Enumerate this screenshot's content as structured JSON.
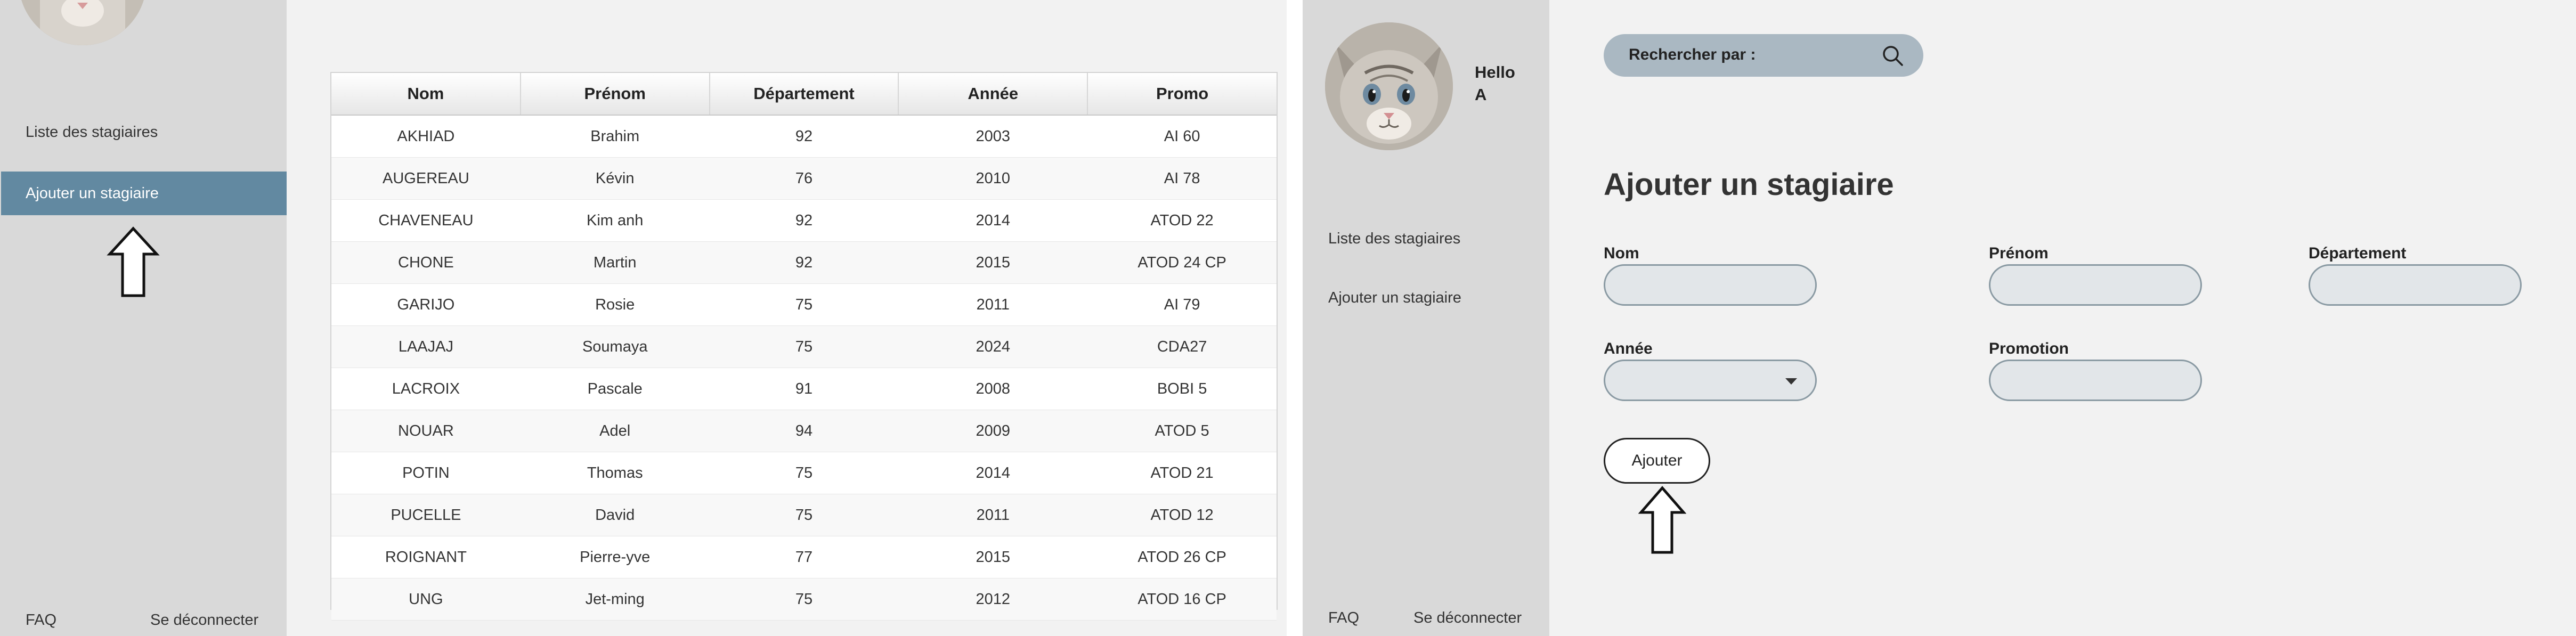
{
  "left": {
    "nav": {
      "list_label": "Liste des stagiaires",
      "add_label": "Ajouter un stagiaire"
    },
    "footer": {
      "faq": "FAQ",
      "logout": "Se déconnecter"
    },
    "table": {
      "headers": [
        "Nom",
        "Prénom",
        "Département",
        "Année",
        "Promo"
      ],
      "rows": [
        [
          "AKHIAD",
          "Brahim",
          "92",
          "2003",
          "AI 60"
        ],
        [
          "AUGEREAU",
          "Kévin",
          "76",
          "2010",
          "AI 78"
        ],
        [
          "CHAVENEAU",
          "Kim anh",
          "92",
          "2014",
          "ATOD 22"
        ],
        [
          "CHONE",
          "Martin",
          "92",
          "2015",
          "ATOD 24 CP"
        ],
        [
          "GARIJO",
          "Rosie",
          "75",
          "2011",
          "AI 79"
        ],
        [
          "LAAJAJ",
          "Soumaya",
          "75",
          "2024",
          "CDA27"
        ],
        [
          "LACROIX",
          "Pascale",
          "91",
          "2008",
          "BOBI 5"
        ],
        [
          "NOUAR",
          "Adel",
          "94",
          "2009",
          "ATOD 5"
        ],
        [
          "POTIN",
          "Thomas",
          "75",
          "2014",
          "ATOD 21"
        ],
        [
          "PUCELLE",
          "David",
          "75",
          "2011",
          "ATOD 12"
        ],
        [
          "ROIGNANT",
          "Pierre-yve",
          "77",
          "2015",
          "ATOD 26 CP"
        ],
        [
          "UNG",
          "Jet-ming",
          "75",
          "2012",
          "ATOD 16 CP"
        ]
      ]
    }
  },
  "right": {
    "greeting_line1": "Hello",
    "greeting_line2": "A",
    "nav": {
      "list_label": "Liste des stagiaires",
      "add_label": "Ajouter un stagiaire"
    },
    "footer": {
      "faq": "FAQ",
      "logout": "Se déconnecter"
    },
    "search": {
      "label": "Rechercher par :",
      "icon": "search-icon"
    },
    "form": {
      "title": "Ajouter un stagiaire",
      "nom_label": "Nom",
      "prenom_label": "Prénom",
      "departement_label": "Département",
      "annee_label": "Année",
      "promotion_label": "Promotion",
      "submit_label": "Ajouter"
    }
  },
  "colors": {
    "sidebar": "#d9d9d9",
    "nav_active": "#6289a1",
    "search_bg": "#aab8c2",
    "input_bg": "#e2e6e9"
  }
}
